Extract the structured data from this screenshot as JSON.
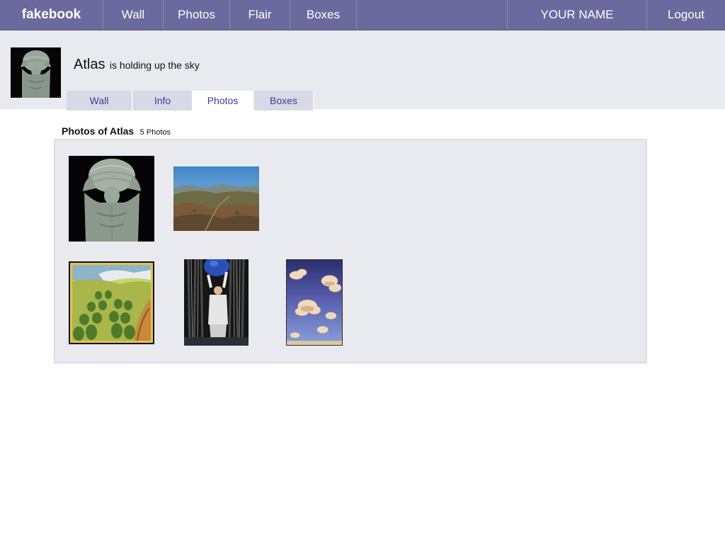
{
  "topbar": {
    "brand": "fakebook",
    "nav": [
      "Wall",
      "Photos",
      "Flair",
      "Boxes"
    ],
    "user_name": "YOUR NAME",
    "logout": "Logout"
  },
  "profile": {
    "name": "Atlas",
    "status": "is holding up the sky",
    "tabs": [
      "Wall",
      "Info",
      "Photos",
      "Boxes"
    ],
    "active_tab": "Photos"
  },
  "photos_section": {
    "title": "Photos of Atlas",
    "count": "5 Photos"
  },
  "colors": {
    "topbar_bg": "#6a6a9e",
    "header_bg": "#e9eaf0",
    "tab_text": "#3b3b9a"
  }
}
